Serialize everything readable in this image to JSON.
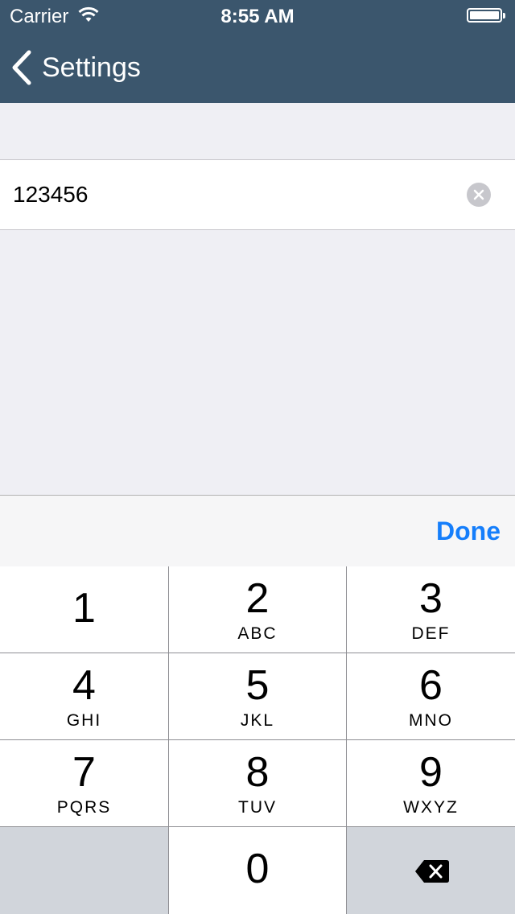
{
  "status_bar": {
    "carrier": "Carrier",
    "time": "8:55 AM",
    "wifi_icon": "wifi-icon",
    "battery_icon": "battery-icon",
    "battery_level": 1.0
  },
  "nav": {
    "back_label": "Settings",
    "back_icon": "chevron-left-icon"
  },
  "field": {
    "value": "123456",
    "clear_icon": "clear-circle-icon"
  },
  "toolbar": {
    "done_label": "Done"
  },
  "keypad": {
    "keys": [
      {
        "digit": "1",
        "letters": ""
      },
      {
        "digit": "2",
        "letters": "ABC"
      },
      {
        "digit": "3",
        "letters": "DEF"
      },
      {
        "digit": "4",
        "letters": "GHI"
      },
      {
        "digit": "5",
        "letters": "JKL"
      },
      {
        "digit": "6",
        "letters": "MNO"
      },
      {
        "digit": "7",
        "letters": "PQRS"
      },
      {
        "digit": "8",
        "letters": "TUV"
      },
      {
        "digit": "9",
        "letters": "WXYZ"
      },
      {
        "digit": "0",
        "letters": ""
      }
    ],
    "delete_icon": "delete-backspace-icon"
  },
  "colors": {
    "nav_bar": "#3b566d",
    "accent": "#157efb",
    "background": "#efeff4"
  }
}
